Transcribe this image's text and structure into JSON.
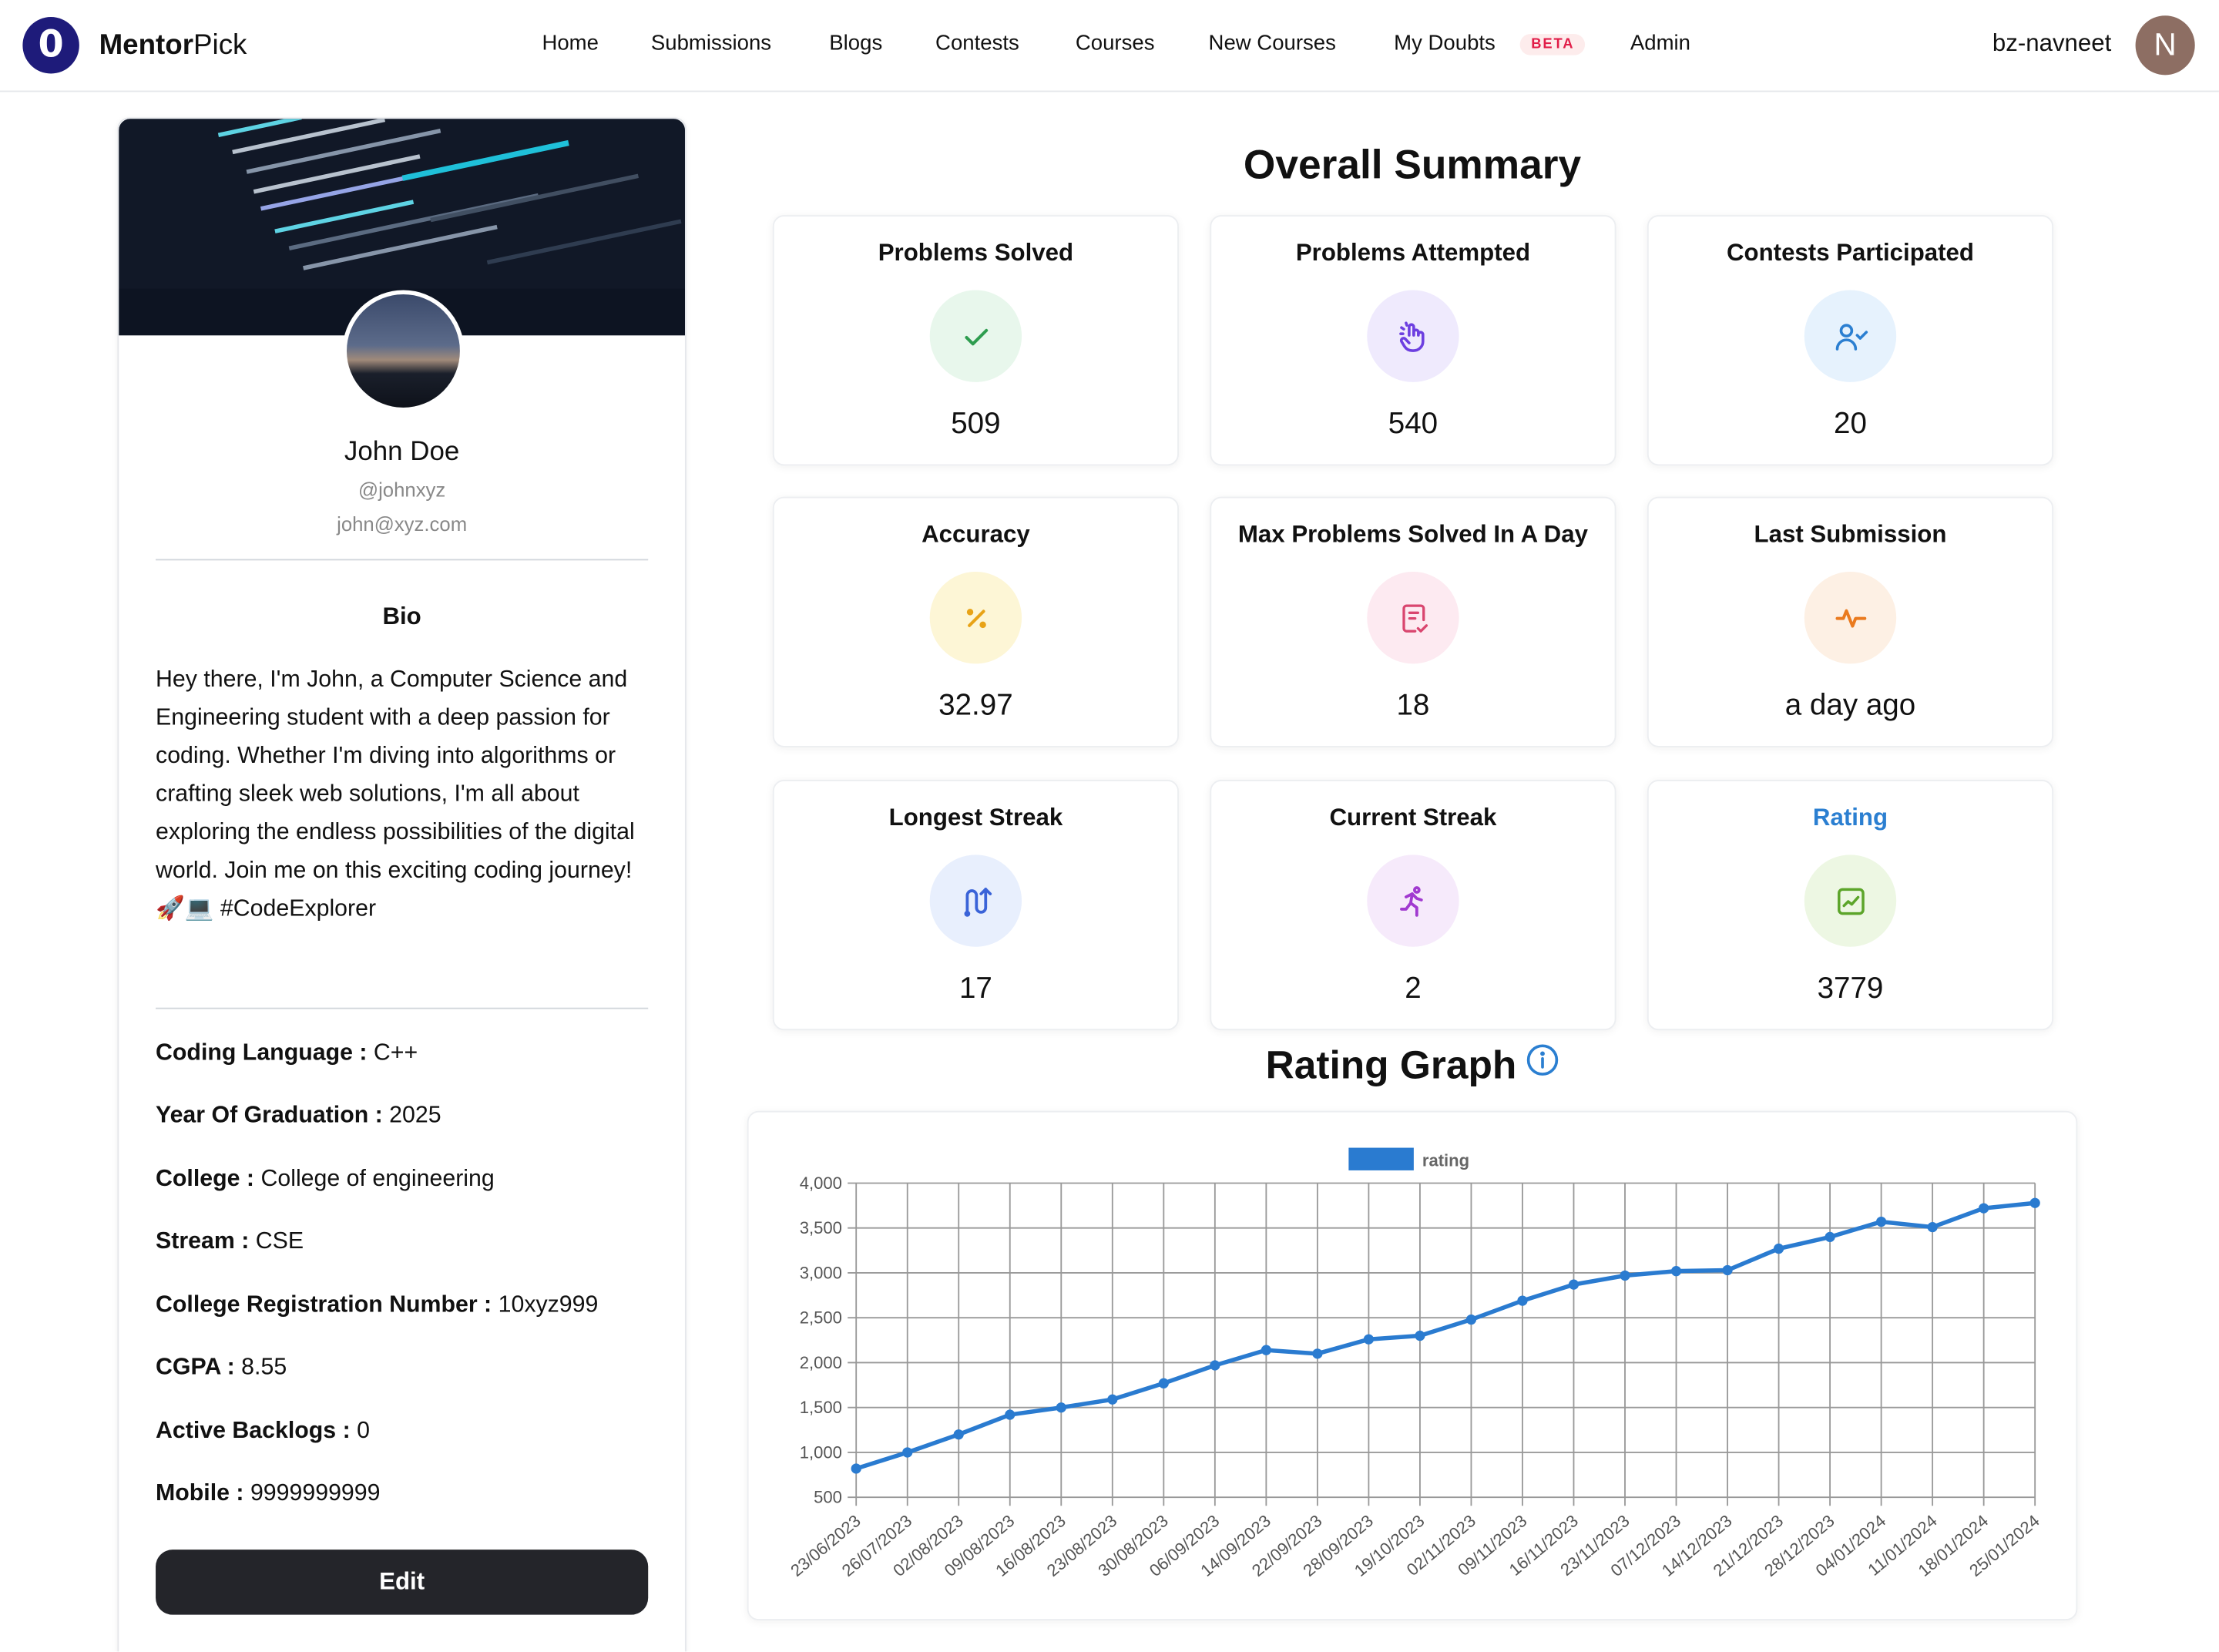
{
  "navbar": {
    "logo_text": "0",
    "brand_bold": "Mentor",
    "brand_light": "Pick",
    "links": [
      {
        "label": "Home"
      },
      {
        "label": "Submissions"
      },
      {
        "label": "Blogs"
      },
      {
        "label": "Contests"
      },
      {
        "label": "Courses"
      },
      {
        "label": "New Courses"
      },
      {
        "label": "My Doubts"
      },
      {
        "label": "Admin"
      }
    ],
    "beta_badge": "BETA",
    "username": "bz-navneet",
    "avatar_initial": "N"
  },
  "profile": {
    "name": "John Doe",
    "handle": "@johnxyz",
    "email": "john@xyz.com",
    "bio_title": "Bio",
    "bio": "Hey there, I'm John, a Computer Science and Engineering student with a deep passion for coding. Whether I'm diving into algorithms or crafting sleek web solutions, I'm all about exploring the endless possibilities of the digital world. Join me on this exciting coding journey! 🚀💻 #CodeExplorer",
    "details": [
      {
        "key": "Coding Language :",
        "value": "C++"
      },
      {
        "key": "Year Of Graduation :",
        "value": "2025"
      },
      {
        "key": "College :",
        "value": "College of engineering"
      },
      {
        "key": "Stream :",
        "value": "CSE"
      },
      {
        "key": "College Registration Number :",
        "value": "10xyz999"
      },
      {
        "key": "CGPA :",
        "value": "8.55"
      },
      {
        "key": "Active Backlogs :",
        "value": "0"
      },
      {
        "key": "Mobile :",
        "value": "9999999999"
      }
    ],
    "edit_label": "Edit"
  },
  "summary": {
    "title": "Overall Summary",
    "stats": [
      {
        "label": "Problems Solved",
        "value": "509",
        "icon": "check-icon",
        "bg": "#e8f7ec",
        "fg": "#2e9d4f"
      },
      {
        "label": "Problems Attempted",
        "value": "540",
        "icon": "pointer-hand-icon",
        "bg": "#efeafd",
        "fg": "#6d3fe0"
      },
      {
        "label": "Contests Participated",
        "value": "20",
        "icon": "user-check-icon",
        "bg": "#e6f2fd",
        "fg": "#2b7fd1"
      },
      {
        "label": "Accuracy",
        "value": "32.97",
        "icon": "percent-icon",
        "bg": "#fdf6d6",
        "fg": "#e8a317"
      },
      {
        "label": "Max Problems Solved In A Day",
        "value": "18",
        "icon": "document-check-icon",
        "bg": "#fdeaf1",
        "fg": "#d9466f"
      },
      {
        "label": "Last Submission",
        "value": "a day ago",
        "icon": "activity-icon",
        "bg": "#fdf0e4",
        "fg": "#ea7a1e"
      },
      {
        "label": "Longest Streak",
        "value": "17",
        "icon": "route-icon",
        "bg": "#e8effd",
        "fg": "#3a63d8"
      },
      {
        "label": "Current Streak",
        "value": "2",
        "icon": "runner-icon",
        "bg": "#f6eafb",
        "fg": "#a13ad0"
      },
      {
        "label": "Rating",
        "value": "3779",
        "icon": "chart-square-icon",
        "bg": "#edf7e3",
        "fg": "#5ca52a"
      }
    ],
    "rating_label_color": "#2b7fd1"
  },
  "rating_graph": {
    "title": "Rating Graph"
  },
  "chart_data": {
    "type": "line",
    "legend": "rating",
    "legend_position": "top",
    "color": "#2a7bd0",
    "grid": true,
    "ylim": [
      500,
      4000
    ],
    "yticks": [
      "500",
      "1,000",
      "1,500",
      "2,000",
      "2,500",
      "3,000",
      "3,500",
      "4,000"
    ],
    "x": [
      "23/06/2023",
      "26/07/2023",
      "02/08/2023",
      "09/08/2023",
      "16/08/2023",
      "23/08/2023",
      "30/08/2023",
      "06/09/2023",
      "14/09/2023",
      "22/09/2023",
      "28/09/2023",
      "19/10/2023",
      "02/11/2023",
      "09/11/2023",
      "16/11/2023",
      "23/11/2023",
      "07/12/2023",
      "14/12/2023",
      "21/12/2023",
      "28/12/2023",
      "04/01/2024",
      "11/01/2024",
      "18/01/2024",
      "25/01/2024"
    ],
    "series": [
      {
        "name": "rating",
        "values": [
          820,
          1000,
          1200,
          1420,
          1500,
          1590,
          1770,
          1970,
          2140,
          2100,
          2260,
          2300,
          2480,
          2690,
          2870,
          2970,
          3020,
          3030,
          3270,
          3400,
          3570,
          3510,
          3720,
          3779
        ]
      }
    ]
  }
}
